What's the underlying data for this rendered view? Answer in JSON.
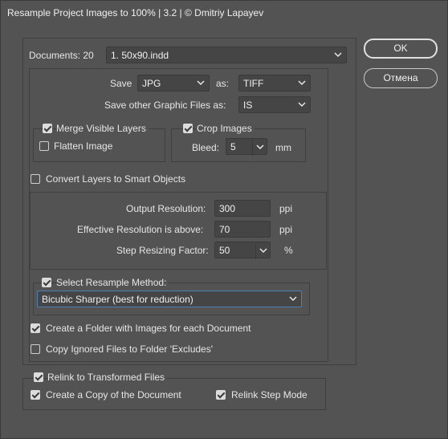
{
  "window": {
    "title": "Resample Project Images to 100% | 3.2 | © Dmitriy Lapayev"
  },
  "buttons": {
    "ok": "OK",
    "cancel": "Отмена"
  },
  "documents": {
    "label": "Documents: 20",
    "selected": "1. 50x90.indd"
  },
  "save": {
    "label": "Save",
    "format": "JPG",
    "as_label": "as:",
    "as_format": "TIFF"
  },
  "save_other": {
    "label": "Save other Graphic Files as:",
    "value": "IS"
  },
  "merge": {
    "label": "Merge Visible Layers",
    "checked": true
  },
  "flatten": {
    "label": "Flatten Image",
    "checked": false
  },
  "crop": {
    "label": "Crop Images",
    "checked": true,
    "bleed_label": "Bleed:",
    "bleed_value": "5",
    "unit": "mm"
  },
  "smart_objects": {
    "label": "Convert Layers to Smart Objects",
    "checked": false
  },
  "resolution": {
    "output_label": "Output Resolution:",
    "output_value": "300",
    "output_unit": "ppi",
    "effective_label": "Effective Resolution is above:",
    "effective_value": "70",
    "effective_unit": "ppi",
    "step_label": "Step Resizing Factor:",
    "step_value": "50",
    "step_unit": "%"
  },
  "resample": {
    "label": "Select Resample Method:",
    "checked": true,
    "method": "Bicubic Sharper (best for reduction)"
  },
  "folder_per_doc": {
    "label": "Create a Folder with Images for each Document",
    "checked": true
  },
  "copy_ignored": {
    "label": "Copy Ignored Files to Folder 'Excludes'",
    "checked": false
  },
  "relink": {
    "label": "Relink to Transformed Files",
    "checked": true
  },
  "copy_doc": {
    "label": "Create a Copy of the Document",
    "checked": true
  },
  "relink_step": {
    "label": "Relink Step Mode",
    "checked": true
  },
  "icons": {
    "dropdown": "chevron-down-icon",
    "checkbox": "checkmark-icon"
  }
}
